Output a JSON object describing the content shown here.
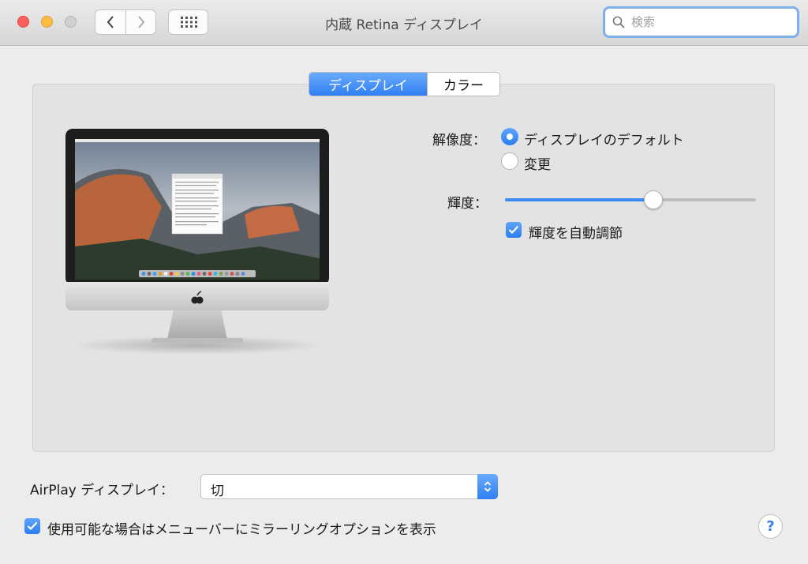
{
  "window": {
    "title": "内蔵 Retina ディスプレイ"
  },
  "search": {
    "placeholder": "検索"
  },
  "tabs": [
    {
      "label": "ディスプレイ",
      "selected": true
    },
    {
      "label": "カラー",
      "selected": false
    }
  ],
  "resolution": {
    "label": "解像度：",
    "options": [
      {
        "label": "ディスプレイのデフォルト",
        "selected": true
      },
      {
        "label": "変更",
        "selected": false
      }
    ]
  },
  "brightness": {
    "label": "輝度：",
    "value_fraction": 0.59,
    "auto_label": "輝度を自動調節",
    "auto_checked": true
  },
  "airplay": {
    "label": "AirPlay ディスプレイ：",
    "selected": "切"
  },
  "mirroring": {
    "label": "使用可能な場合はメニューバーにミラーリングオプションを表示",
    "checked": true
  },
  "help": {
    "label": "?"
  },
  "colors": {
    "accent": "#3a88f4",
    "background": "#ececec"
  }
}
